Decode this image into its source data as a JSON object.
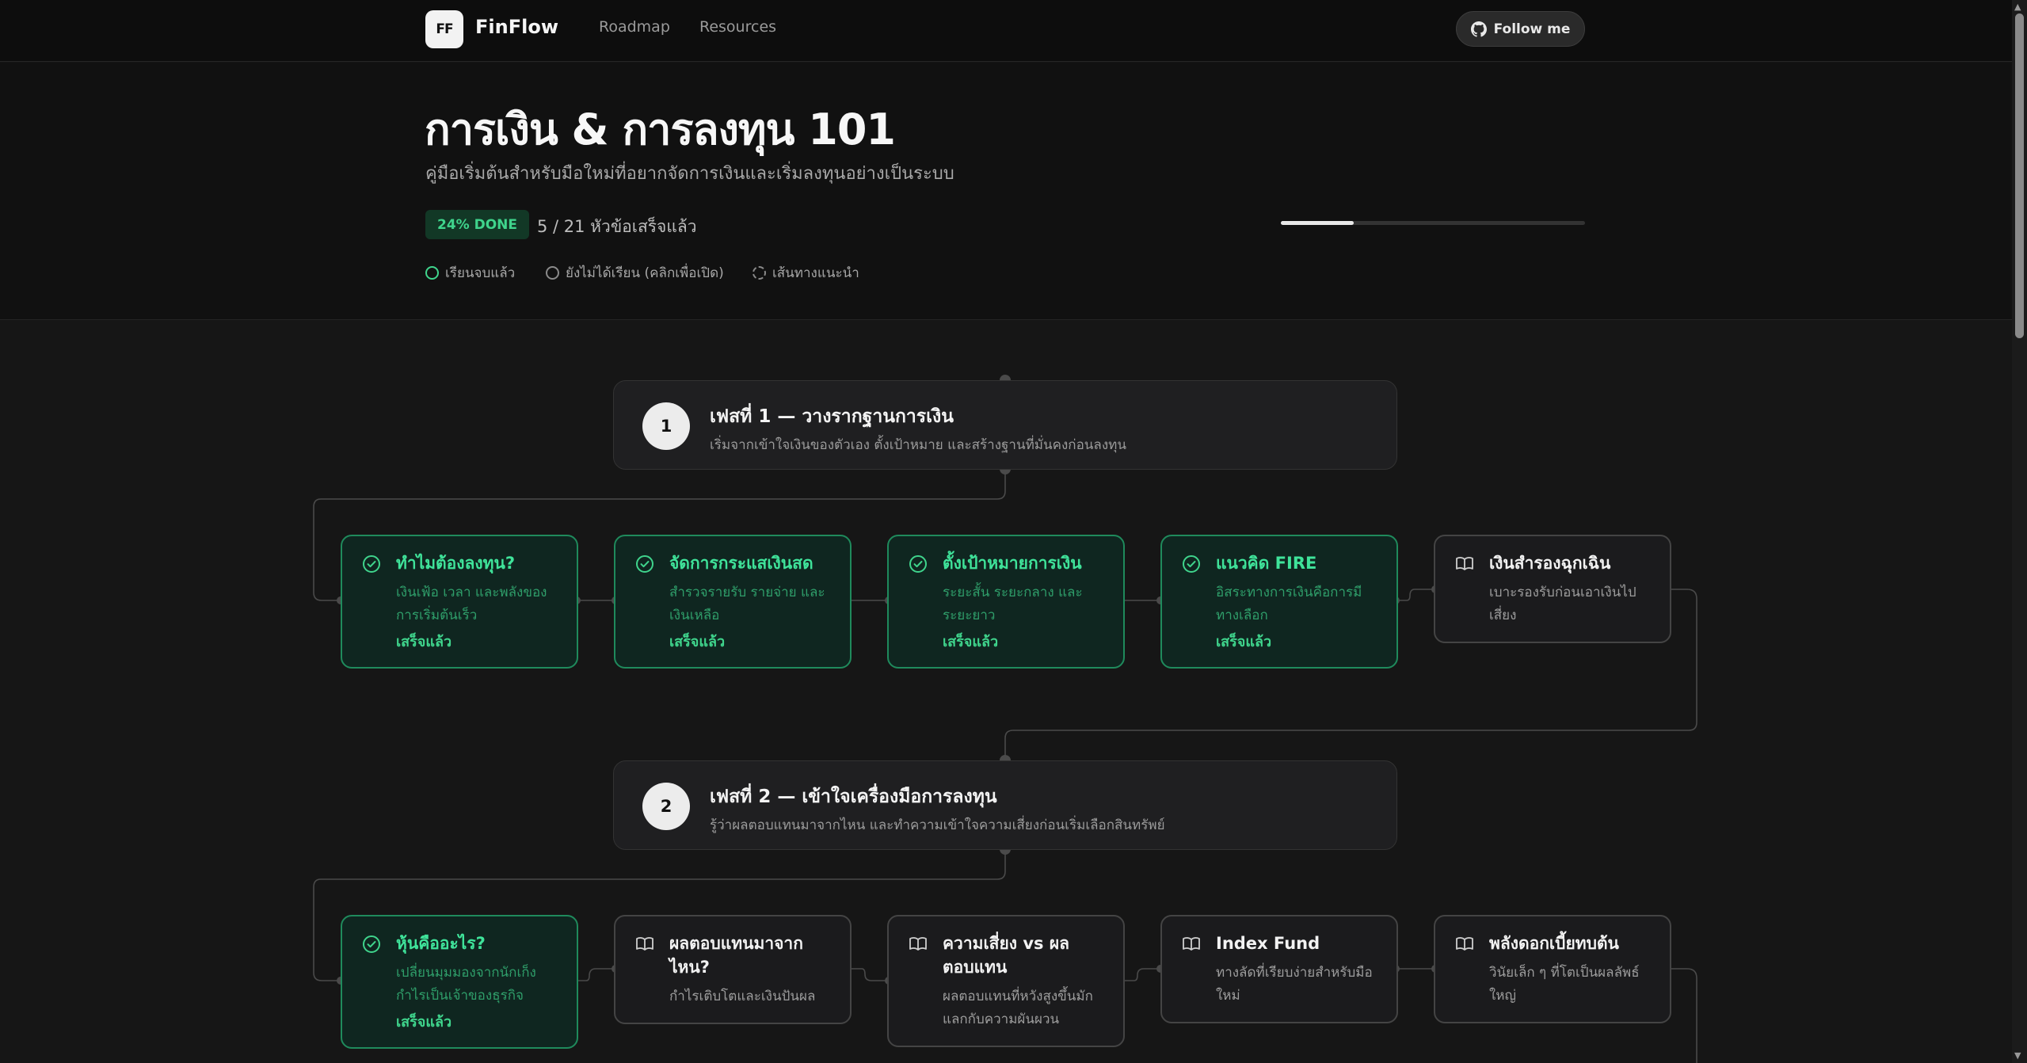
{
  "header": {
    "logo": "FF",
    "brand": "FinFlow",
    "nav": [
      "Roadmap",
      "Resources"
    ],
    "follow_label": "Follow me",
    "follow_icon": "github-icon"
  },
  "hero": {
    "title": "การเงิน & การลงทุน 101",
    "subtitle": "คู่มือเริ่มต้นสำหรับมือใหม่ที่อยากจัดการเงินและเริ่มลงทุนอย่างเป็นระบบ",
    "done_badge": "24% DONE",
    "done_count": "5 / 21 หัวข้อเสร็จแล้ว",
    "progress_fraction": 0.24,
    "legend": [
      {
        "label": "เรียนจบแล้ว",
        "kind": "done",
        "color": "#3fd48c"
      },
      {
        "label": "ยังไม่ได้เรียน (คลิกเพื่อเปิด)",
        "kind": "todo",
        "color": "#9a9a9a"
      },
      {
        "label": "เส้นทางแนะนำ",
        "kind": "path",
        "color": "#9a9a9a"
      }
    ]
  },
  "phases": [
    {
      "num": "1",
      "title": "เฟสที่ 1 — วางรากฐานการเงิน",
      "desc": "เริ่มจากเข้าใจเงินของตัวเอง ตั้งเป้าหมาย และสร้างฐานที่มั่นคงก่อนลงทุน",
      "cards": [
        {
          "title": "ทำไมต้องลงทุน?",
          "desc": "เงินเฟ้อ เวลา และพลังของการเริ่มต้นเร็ว",
          "status": "เสร็จแล้ว",
          "done": true
        },
        {
          "title": "จัดการกระแสเงินสด",
          "desc": "สำรวจรายรับ รายจ่าย และเงินเหลือ",
          "status": "เสร็จแล้ว",
          "done": true
        },
        {
          "title": "ตั้งเป้าหมายการเงิน",
          "desc": "ระยะสั้น ระยะกลาง และระยะยาว",
          "status": "เสร็จแล้ว",
          "done": true
        },
        {
          "title": "แนวคิด FIRE",
          "desc": "อิสระทางการเงินคือการมีทางเลือก",
          "status": "เสร็จแล้ว",
          "done": true
        },
        {
          "title": "เงินสำรองฉุกเฉิน",
          "desc": "เบาะรองรับก่อนเอาเงินไปเสี่ยง",
          "status": "",
          "done": false
        }
      ]
    },
    {
      "num": "2",
      "title": "เฟสที่ 2 — เข้าใจเครื่องมือการลงทุน",
      "desc": "รู้ว่าผลตอบแทนมาจากไหน และทำความเข้าใจความเสี่ยงก่อนเริ่มเลือกสินทรัพย์",
      "cards": [
        {
          "title": "หุ้นคืออะไร?",
          "desc": "เปลี่ยนมุมมองจากนักเก็งกำไรเป็นเจ้าของธุรกิจ",
          "status": "เสร็จแล้ว",
          "done": true
        },
        {
          "title": "ผลตอบแทนมาจากไหน?",
          "desc": "กำไรเติบโตและเงินปันผล",
          "status": "",
          "done": false
        },
        {
          "title": "ความเสี่ยง vs ผลตอบแทน",
          "desc": "ผลตอบแทนที่หวังสูงขึ้นมักแลกกับความผันผวน",
          "status": "",
          "done": false
        },
        {
          "title": "Index Fund",
          "desc": "ทางลัดที่เรียบง่ายสำหรับมือใหม่",
          "status": "",
          "done": false
        },
        {
          "title": "พลังดอกเบี้ยทบต้น",
          "desc": "วินัยเล็ก ๆ ที่โตเป็นผลลัพธ์ใหญ่",
          "status": "",
          "done": false
        }
      ]
    }
  ]
}
